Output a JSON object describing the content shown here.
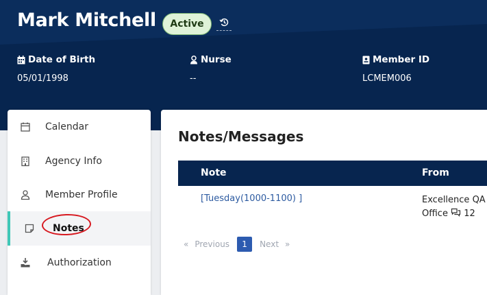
{
  "header": {
    "member_name": "Mark Mitchell",
    "status": "Active",
    "fields": [
      {
        "label": "Date of Birth",
        "value": "05/01/1998",
        "icon": "calendar-icon"
      },
      {
        "label": "Nurse",
        "value": "--",
        "icon": "nurse-icon"
      },
      {
        "label": "Member ID",
        "value": "LCMEM006",
        "icon": "id-card-icon"
      }
    ]
  },
  "sidebar": {
    "items": [
      {
        "label": "Calendar",
        "icon": "calendar-icon"
      },
      {
        "label": "Agency Info",
        "icon": "building-icon"
      },
      {
        "label": "Member Profile",
        "icon": "user-icon"
      },
      {
        "label": "Notes",
        "icon": "note-icon",
        "active": true
      },
      {
        "label": "Authorization",
        "icon": "authorization-icon"
      }
    ]
  },
  "main": {
    "title": "Notes/Messages",
    "columns": [
      "Note",
      "From"
    ],
    "rows": [
      {
        "note": "[Tuesday(1000-1100) ]",
        "from_line1": "Excellence QA",
        "from_line2": "Office",
        "comment_count": "12"
      }
    ],
    "pagination": {
      "prev_symbol": "«",
      "prev_label": "Previous",
      "current": "1",
      "next_label": "Next",
      "next_symbol": "»"
    }
  },
  "colors": {
    "header_bg": "#07254f",
    "accent": "#3fc7b7",
    "link": "#2c5aa0",
    "badge_bg": "#dff2d8",
    "annotation": "#d71920"
  }
}
